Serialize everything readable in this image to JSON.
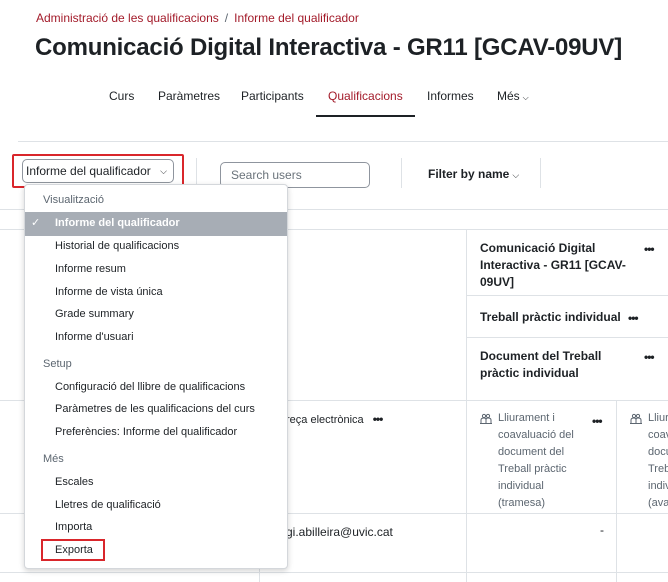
{
  "breadcrumb": {
    "items": [
      "Administració de les qualificacions",
      "Informe del qualificador"
    ],
    "separator": "/"
  },
  "page_title": "Comunicació Digital Interactiva - GR11 [GCAV-09UV]",
  "course_nav": {
    "items": [
      "Curs",
      "Paràmetres",
      "Participants",
      "Qualificacions",
      "Informes",
      "Més"
    ],
    "active": "Qualificacions"
  },
  "toolbar": {
    "report_select_value": "Informe del qualificador",
    "search_placeholder": "Search users",
    "filter_label": "Filter by name"
  },
  "dropdown": {
    "sections": [
      {
        "header": "Visualització",
        "items": [
          "Informe del qualificador",
          "Historial de qualificacions",
          "Informe resum",
          "Informe de vista única",
          "Grade summary",
          "Informe d'usuari"
        ]
      },
      {
        "header": "Setup",
        "items": [
          "Configuració del llibre de qualificacions",
          "Paràmetres de les qualificacions del curs",
          "Preferències: Informe del qualificador"
        ]
      },
      {
        "header": "Més",
        "items": [
          "Escales",
          "Lletres de qualificació",
          "Importa",
          "Exporta"
        ]
      }
    ],
    "selected_item": "Informe del qualificador",
    "highlighted_item": "Exporta"
  },
  "grid": {
    "category_course": "Comunicació Digital Interactiva - GR11 [GCAV-09UV]",
    "category_course_lines": [
      "Comunicació Digital",
      "Interactiva - GR11 [GCAV-",
      "09UV]"
    ],
    "category_assignment": "Treball pràctic individual",
    "category_document": "Document del Treball pràctic individual",
    "category_document_lines": [
      "Document del Treball",
      "pràctic individual"
    ],
    "email_column_header": "reça electrònica",
    "item1_lines": [
      "Lliurament i",
      "coavaluació del",
      "document del",
      "Treball pràctic",
      "individual",
      "(tramesa)"
    ],
    "item2_lines": [
      "Lliur",
      "coav",
      "docu",
      "Trebl",
      "indiv",
      "(ava"
    ],
    "row1_email": "gi.abilleira@uvic.cat",
    "row1_grade": "-",
    "menu_dots": "•••"
  },
  "icons": {
    "check": "check-icon",
    "chevron": "chevron-down-icon",
    "assignment": "assignment-icon",
    "menu": "more-actions-icon"
  },
  "colors": {
    "brand_red": "#a31b2a",
    "highlight_red": "#d9262b",
    "selected_bg": "#a7adb5"
  }
}
